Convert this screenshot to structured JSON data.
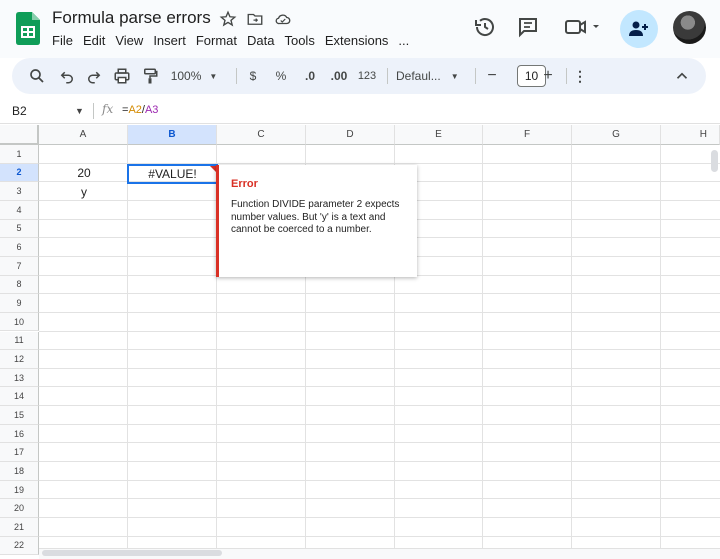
{
  "doc": {
    "title": "Formula parse errors",
    "menu": [
      "File",
      "Edit",
      "View",
      "Insert",
      "Format",
      "Data",
      "Tools",
      "Extensions",
      "..."
    ]
  },
  "toolbar": {
    "zoom": "100%",
    "currency": "$",
    "percent": "%",
    "decrease_decimal": ".0",
    "increase_decimal": ".00",
    "number_format": "123",
    "font": "Defaul...",
    "minus": "−",
    "font_size": "10",
    "plus": "+",
    "more": "⋮",
    "collapse": "^"
  },
  "formula_bar": {
    "name_box": "B2",
    "fx": "fx",
    "formula_eq": "=",
    "formula_ref1": "A2",
    "formula_op": "/",
    "formula_ref2": "A3"
  },
  "columns": [
    "A",
    "B",
    "C",
    "D",
    "E",
    "F",
    "G",
    "H"
  ],
  "rows": [
    "1",
    "2",
    "3",
    "4",
    "5",
    "6",
    "7",
    "8",
    "9",
    "10",
    "11",
    "12",
    "13",
    "14",
    "15",
    "16",
    "17",
    "18",
    "19",
    "20",
    "21",
    "22"
  ],
  "cells": {
    "A2": "20",
    "B2": "#VALUE!",
    "A3": "y"
  },
  "error_popup": {
    "title": "Error",
    "message": "Function DIVIDE parameter 2 expects number values. But 'y' is a text and cannot be coerced to a number."
  },
  "colors": {
    "accent": "#1a73e8",
    "error": "#d93025",
    "header_selected": "#d3e3fd",
    "toolbar_bg": "#edf2fa"
  }
}
